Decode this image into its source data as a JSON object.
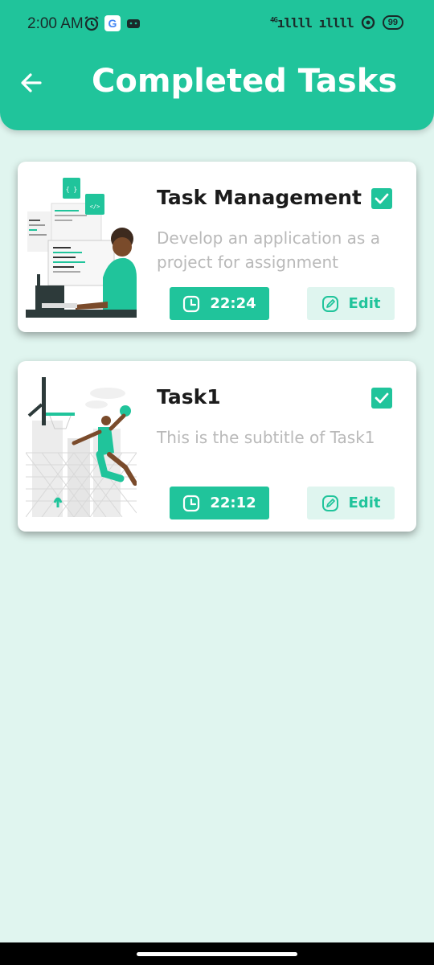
{
  "status_bar": {
    "time": "2:00 AM",
    "network": "4G",
    "signal": "ıllll ıllll",
    "battery": "99",
    "icons": [
      "alarm-icon",
      "google-icon",
      "android-icon",
      "hotspot-icon"
    ]
  },
  "header": {
    "title": "Completed Tasks",
    "back_icon": "arrow-left-icon"
  },
  "colors": {
    "primary": "#20c49b",
    "background": "#e0f5ef",
    "edit_bg": "#dff5ef"
  },
  "tasks": [
    {
      "title": "Task Management",
      "subtitle": "Develop an application as a project for assignment",
      "time": "22:24",
      "edit_label": "Edit",
      "completed": true,
      "image_icon": "developer-illustration"
    },
    {
      "title": "Task1",
      "subtitle": "This is the subtitle of Task1",
      "time": "22:12",
      "edit_label": "Edit",
      "completed": true,
      "image_icon": "basketball-illustration"
    }
  ]
}
